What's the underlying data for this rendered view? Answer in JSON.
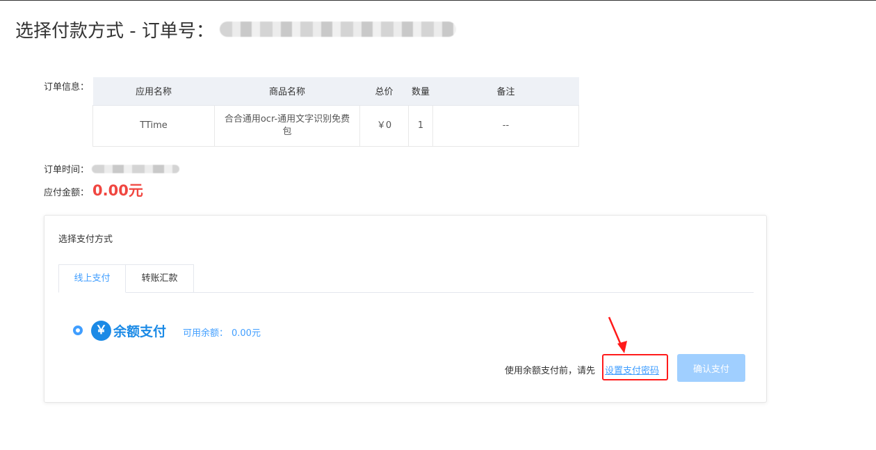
{
  "header": {
    "title": "选择付款方式 - 订单号："
  },
  "order": {
    "info_label": "订单信息：",
    "columns": [
      "应用名称",
      "商品名称",
      "总价",
      "数量",
      "备注"
    ],
    "row": {
      "app_name": "TTime",
      "product_name": "合合通用ocr-通用文字识别免费包",
      "total_price": "￥0",
      "quantity": "1",
      "remark": "--"
    },
    "time_label": "订单时间：",
    "amount_label": "应付金额：",
    "amount_value": "0.00元"
  },
  "payment": {
    "title": "选择支付方式",
    "tabs": [
      {
        "label": "线上支付",
        "active": true
      },
      {
        "label": "转账汇款",
        "active": false
      }
    ],
    "method_icon": "yen-icon",
    "method_label": "余额支付",
    "method_glyph": "￥",
    "available_label": "可用余额：",
    "available_value": "0.00元",
    "hint": "使用余额支付前，请先",
    "set_password_link": "设置支付密码",
    "confirm_button": "确认支付"
  },
  "colors": {
    "accent": "#409eff",
    "amount": "#f04640",
    "annotation": "#ff1a1a",
    "disabled_button": "#a0cfff"
  }
}
